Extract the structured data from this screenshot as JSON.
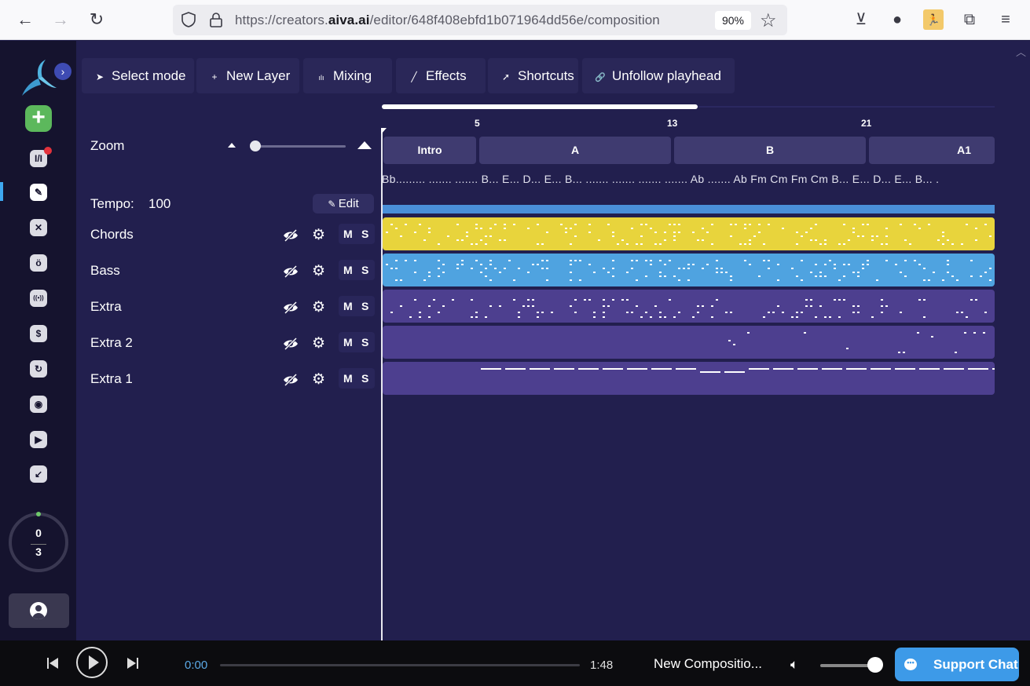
{
  "browser": {
    "url_prefix": "https://creators.",
    "url_domain": "aiva.ai",
    "url_path": "/editor/648f408ebfd1b071964dd56e/composition",
    "zoom_level": "90%"
  },
  "sidebar": {
    "expand_icon": "›",
    "add_icon": "+",
    "items": [
      {
        "name": "compositions",
        "glyph": "I/I",
        "notification": true
      },
      {
        "name": "editor",
        "glyph": "✎",
        "active": true
      },
      {
        "name": "styles",
        "glyph": "✕"
      },
      {
        "name": "mentions",
        "glyph": "ö"
      },
      {
        "name": "broadcast",
        "glyph": "((•))"
      },
      {
        "name": "pricing",
        "glyph": "$"
      },
      {
        "name": "history",
        "glyph": "↻"
      },
      {
        "name": "discord",
        "glyph": "◉"
      },
      {
        "name": "tutorials",
        "glyph": "▶"
      },
      {
        "name": "download",
        "glyph": "↙"
      }
    ],
    "credits": {
      "used": "0",
      "total": "3"
    }
  },
  "toolbar": {
    "buttons": [
      {
        "label": "Select mode",
        "icon": "➤"
      },
      {
        "label": "New Layer",
        "icon": "+"
      },
      {
        "label": "Mixing",
        "icon": "ılı"
      },
      {
        "label": "Effects",
        "icon": "╱"
      },
      {
        "label": "Shortcuts",
        "icon": "➚"
      },
      {
        "label": "Unfollow playhead",
        "icon": "🔗"
      }
    ]
  },
  "zoom": {
    "label": "Zoom",
    "level": 0.05
  },
  "tempo": {
    "label": "Tempo:",
    "value": "100",
    "edit_label": "Edit"
  },
  "timeline": {
    "bar_numbers": [
      "5",
      "13",
      "21"
    ],
    "sections": [
      "Intro",
      "A",
      "B",
      "A1"
    ],
    "chords": "Bb......... ....... ....... B...  E...  D...  E...  B...  ....... ....... ....... ....... Ab  ....... Ab  Fm  Cm  Fm  Cm  B...  E...  D...  E...  B...  .",
    "visible_fraction": 0.51
  },
  "tracks": [
    {
      "name": "Chords",
      "color": "#e8d43c",
      "mute": "M",
      "solo": "S"
    },
    {
      "name": "Bass",
      "color": "#4fa3e0",
      "mute": "M",
      "solo": "S"
    },
    {
      "name": "Extra",
      "color": "#4d3f8f",
      "mute": "M",
      "solo": "S"
    },
    {
      "name": "Extra 2",
      "color": "#4d3f8f",
      "mute": "M",
      "solo": "S"
    },
    {
      "name": "Extra 1",
      "color": "#4d3f8f",
      "mute": "M",
      "solo": "S"
    }
  ],
  "player": {
    "current_time": "0:00",
    "duration": "1:48",
    "progress": 0,
    "title": "New Compositio...",
    "volume": 1.0,
    "support_label": "Support Chat"
  }
}
